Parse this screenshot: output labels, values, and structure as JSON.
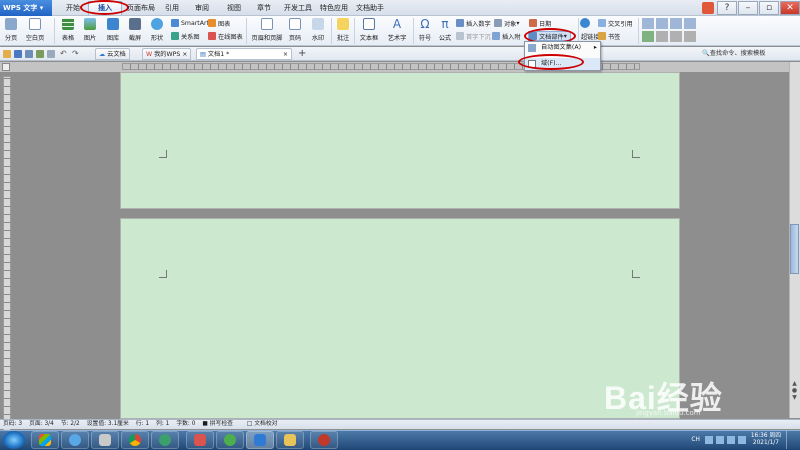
{
  "app": {
    "brand": "WPS 文字"
  },
  "menu": [
    "开始",
    "插入",
    "页面布局",
    "引用",
    "审阅",
    "视图",
    "章节",
    "开发工具",
    "特色应用",
    "文档助手"
  ],
  "ribbon": {
    "big": [
      "分页",
      "空白页",
      "表格",
      "图片",
      "图库",
      "截屏",
      "形状",
      "页眉和页脚",
      "页码",
      "水印",
      "批注",
      "文本框",
      "艺术字",
      "符号",
      "公式"
    ],
    "small": {
      "smartart": "SmartArt",
      "chart": "图表",
      "relation": "关系图",
      "online_chart": "在线图表",
      "insert_number": "插入数字",
      "object": "对象",
      "date": "日期",
      "first_letter": "首字下沉",
      "insert_attach": "插入附",
      "doc_parts": "文档部件",
      "hyperlink": "超链接",
      "bookmark": "书签",
      "cross_ref": "交叉引用"
    }
  },
  "doc_tabs": [
    "云文档",
    "我的WPS",
    "文档1 *"
  ],
  "dropdown": {
    "items": [
      "自动图文集(A)",
      "域(F)..."
    ]
  },
  "search": {
    "placeholder": "查找命令、搜索模板"
  },
  "status": [
    "页码: 3",
    "页面: 3/4",
    "节: 2/2",
    "设置值: 3.1厘米",
    "行: 1",
    "列: 1",
    "字数: 0",
    "拼写检查",
    "文档校对"
  ],
  "tray": {
    "lang": "CH",
    "time": "16:36 周四",
    "date": "2021/1/7"
  },
  "watermark": {
    "main": "Bai经验",
    "sub": "jingyan.baidu.com"
  },
  "colors": {
    "page": "#cce8cf",
    "highlight": "#cc0000"
  }
}
